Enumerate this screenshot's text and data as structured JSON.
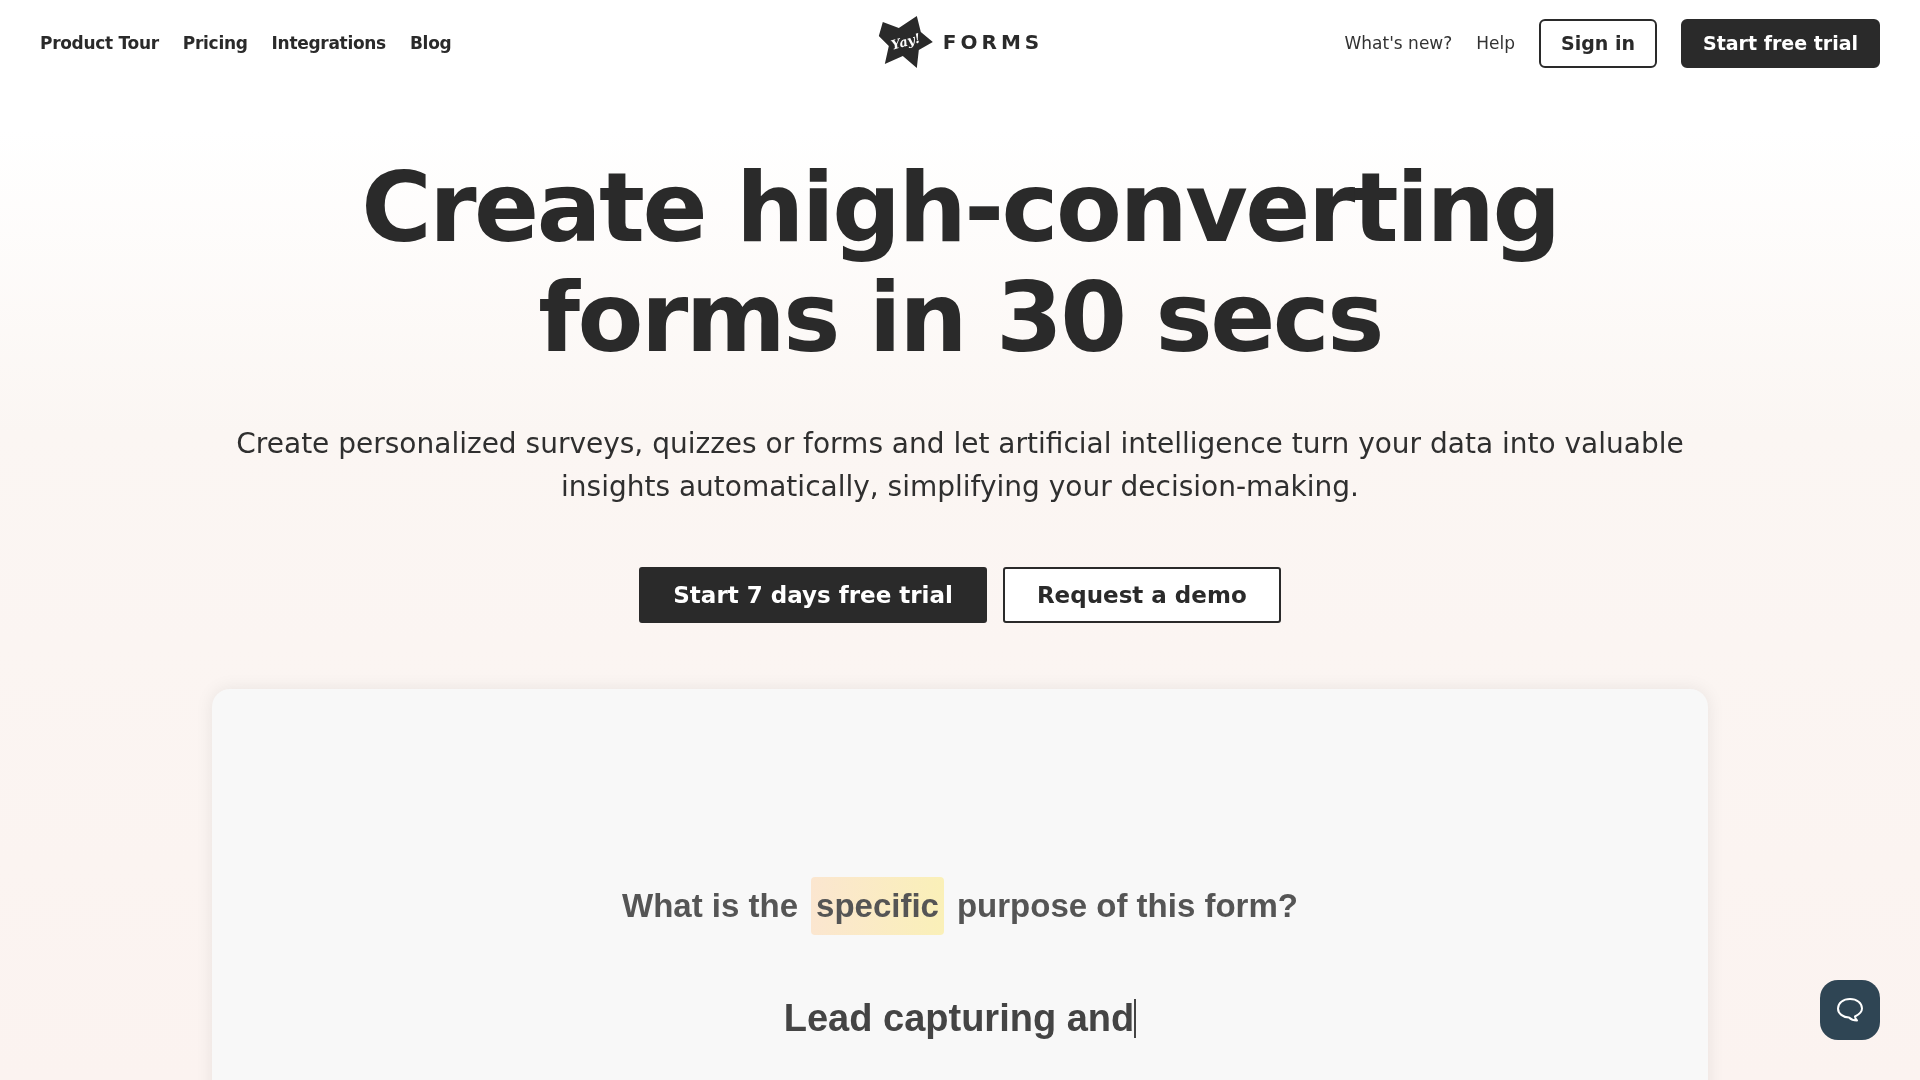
{
  "nav_left": [
    "Product Tour",
    "Pricing",
    "Integrations",
    "Blog"
  ],
  "logo": {
    "mark": "Yay!",
    "wordmark": "FORMS"
  },
  "nav_right": {
    "links": [
      "What's new?",
      "Help"
    ],
    "sign_in": "Sign in",
    "trial": "Start free trial"
  },
  "hero": {
    "title": "Create high-converting forms in 30 secs",
    "subtitle": "Create personalized surveys, quizzes or forms and let artificial intelligence turn your data into valuable insights automatically, simplifying your decision-making.",
    "primary": "Start 7 days free trial",
    "secondary": "Request a demo"
  },
  "demo": {
    "question": [
      {
        "text": "What is the",
        "highlight": false
      },
      {
        "text": "specific",
        "highlight": true
      },
      {
        "text": "purpose of this form?",
        "highlight": false
      }
    ],
    "answer": "Lead capturing and"
  }
}
